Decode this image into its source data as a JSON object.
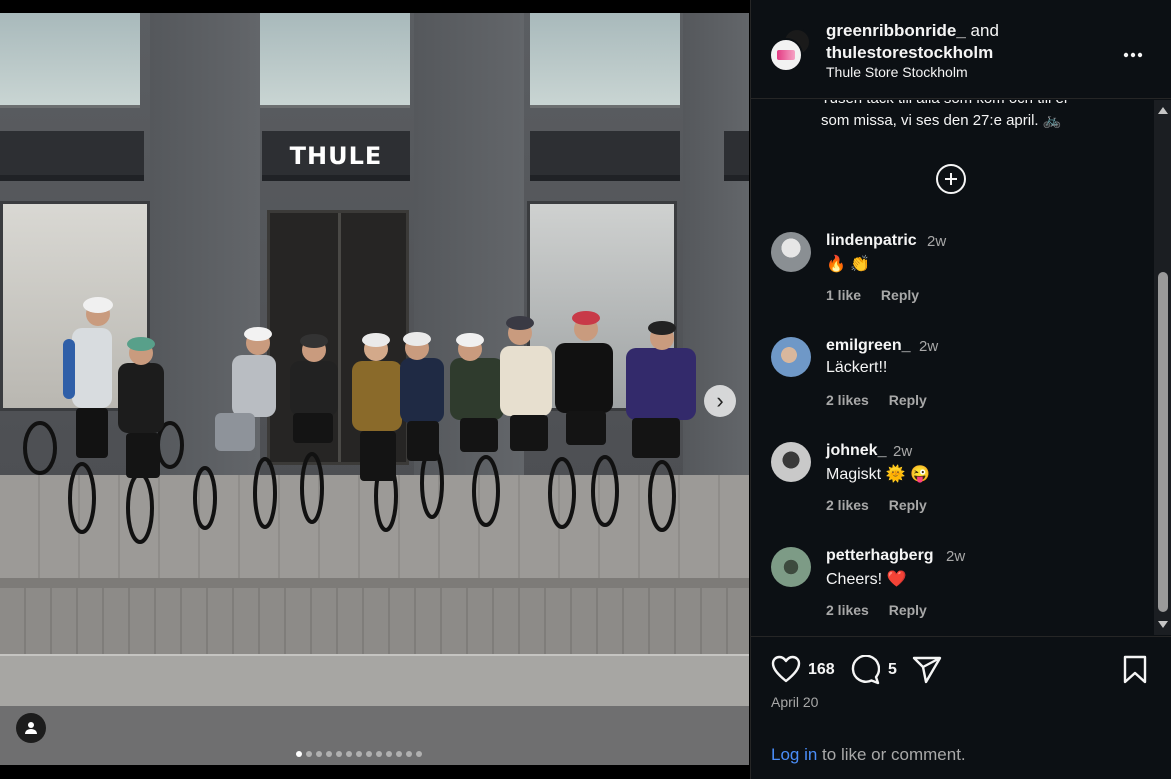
{
  "photo": {
    "store_sign": "THULE",
    "next_icon": "chevron-right-icon",
    "tag_icon": "person-tag-icon",
    "carousel_count": 13,
    "carousel_active_index": 0
  },
  "post": {
    "owner_primary": "greenribbonride_",
    "owner_joiner": "and",
    "owner_secondary": "thulestorestockholm",
    "location": "Thule Store Stockholm",
    "more_icon": "more-dots-icon",
    "caption_line1": "Tusen tack till alla som kom och till er",
    "caption_line2": "som missa, vi ses den 27:e april. 🚲",
    "load_more_icon": "plus-circle-icon"
  },
  "comments": [
    {
      "user": "lindenpatric",
      "time": "2w",
      "text": "🔥 👏",
      "likes": "1 like",
      "reply": "Reply",
      "avatar_color": "#8a8f93"
    },
    {
      "user": "emilgreen_",
      "time": "2w",
      "text": "Läckert!!",
      "likes": "2 likes",
      "reply": "Reply",
      "avatar_color": "#6f98c7"
    },
    {
      "user": "johnek_",
      "time": "2w",
      "text": "Magiskt 🌞 😜",
      "likes": "2 likes",
      "reply": "Reply",
      "avatar_color": "#c9c9c9"
    },
    {
      "user": "petterhagberg",
      "time": "2w",
      "text": "Cheers! ❤️",
      "likes": "2 likes",
      "reply": "Reply",
      "avatar_color": "#7d9b86"
    }
  ],
  "actions": {
    "like_icon": "heart-icon",
    "like_count": "168",
    "comment_icon": "comment-icon",
    "comment_count": "5",
    "share_icon": "share-icon",
    "save_icon": "bookmark-icon",
    "date": "April 20",
    "login_link": "Log in",
    "login_rest": " to like or comment."
  },
  "colors": {
    "panel_bg": "#0c1014",
    "link_blue": "#4a8df8",
    "muted_text": "#a8a8a8"
  }
}
